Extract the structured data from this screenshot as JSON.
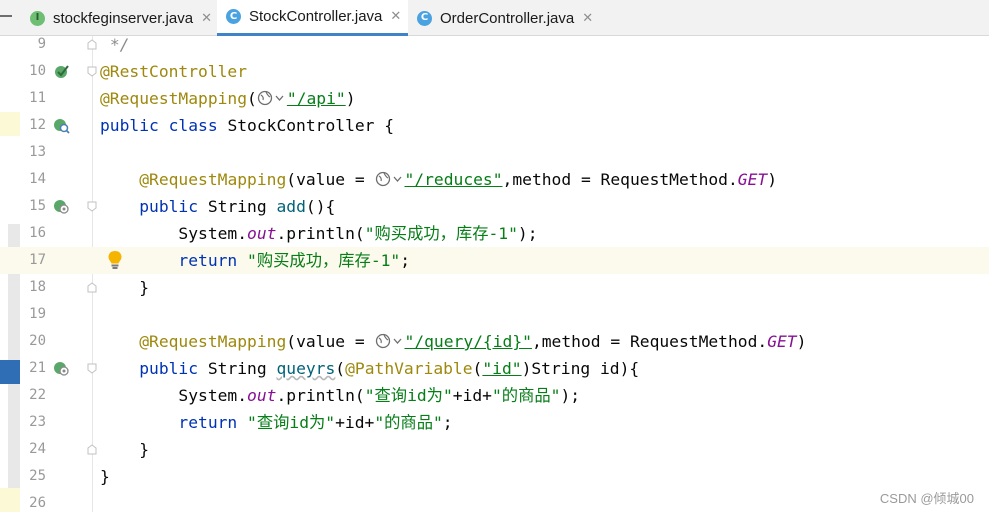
{
  "tabs": [
    {
      "name": "stockfeginserver.java",
      "icon": "interface-icon",
      "icon_letter": "I",
      "active": false
    },
    {
      "name": "StockController.java",
      "icon": "class-icon",
      "icon_letter": "C",
      "active": true
    },
    {
      "name": "OrderController.java",
      "icon": "class-icon",
      "icon_letter": "C",
      "active": false
    }
  ],
  "tab_close_glyph": "✕",
  "line_numbers": {
    "l9": "9",
    "l10": "10",
    "l11": "11",
    "l12": "12",
    "l13": "13",
    "l14": "14",
    "l15": "15",
    "l16": "16",
    "l17": "17",
    "l18": "18",
    "l19": "19",
    "l20": "20",
    "l21": "21",
    "l22": "22",
    "l23": "23",
    "l24": "24",
    "l25": "25",
    "l26": "26"
  },
  "code": {
    "l9": "*/",
    "l10": "@RestController",
    "l11": {
      "ann": "@RequestMapping",
      "open": "(",
      "path": "\"/api\"",
      "close": ")"
    },
    "l12": {
      "kw": "public class ",
      "name": "StockController {"
    },
    "l14": {
      "ann": "@RequestMapping",
      "pre": "(value = ",
      "path": "\"/reduces\"",
      "mid": ",method = RequestMethod.",
      "const": "GET",
      "close": ")"
    },
    "l15": {
      "kw": "public ",
      "type": "String ",
      "method": "add",
      "rest": "(){"
    },
    "l16": {
      "pre": "System.",
      "field": "out",
      "mid": ".println(",
      "str": "\"购买成功，库存-1\"",
      "close": ");"
    },
    "l17": {
      "kw": "return ",
      "str": "\"购买成功，库存-1\"",
      "close": ";"
    },
    "l18": "}",
    "l20": {
      "ann": "@RequestMapping",
      "pre": "(value = ",
      "path": "\"/query/{id}\"",
      "mid": ",method = RequestMethod.",
      "const": "GET",
      "close": ")"
    },
    "l21": {
      "kw": "public ",
      "type": "String ",
      "method": "queyrs",
      "open": "(",
      "ann": "@PathVariable",
      "p_open": "(",
      "p_str": "\"id\"",
      "rest": ")String id){"
    },
    "l22": {
      "pre": "System.",
      "field": "out",
      "mid": ".println(",
      "s1": "\"查询id为\"",
      "plus1": "+id+",
      "s2": "\"的商品\"",
      "close": ");"
    },
    "l23": {
      "kw": "return ",
      "s1": "\"查询id为\"",
      "plus1": "+id+",
      "s2": "\"的商品\"",
      "close": ";"
    },
    "l24": "}",
    "l25": "}"
  },
  "watermark": "CSDN @倾城00",
  "colors": {
    "keyword": "#0033b3",
    "annotation": "#9e880d",
    "string": "#067d17",
    "static_field": "#871094",
    "method": "#00627a",
    "active_tab_underline": "#4083c9",
    "current_line": "#fcfaed"
  }
}
